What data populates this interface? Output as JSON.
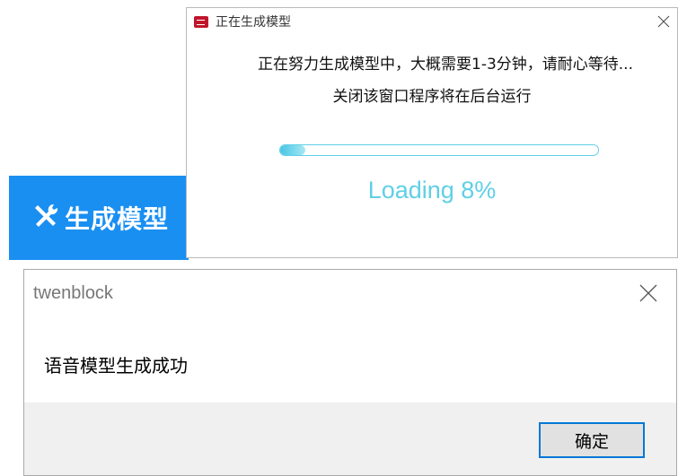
{
  "generate_button": {
    "label": "生成模型",
    "icon": "tools-icon"
  },
  "progress_dialog": {
    "title": "正在生成模型",
    "message_line1": "正在努力生成模型中，大概需要1-3分钟，请耐心等待...",
    "message_line2": "关闭该窗口程序将在后台运行",
    "progress_percent": 8,
    "loading_text": "Loading 8%",
    "accent_color": "#5fcfe6"
  },
  "message_box": {
    "title": "twenblock",
    "text": "语音模型生成成功",
    "ok_label": "确定"
  },
  "colors": {
    "primary_blue": "#1a8ff2",
    "button_border": "#0078d7"
  }
}
